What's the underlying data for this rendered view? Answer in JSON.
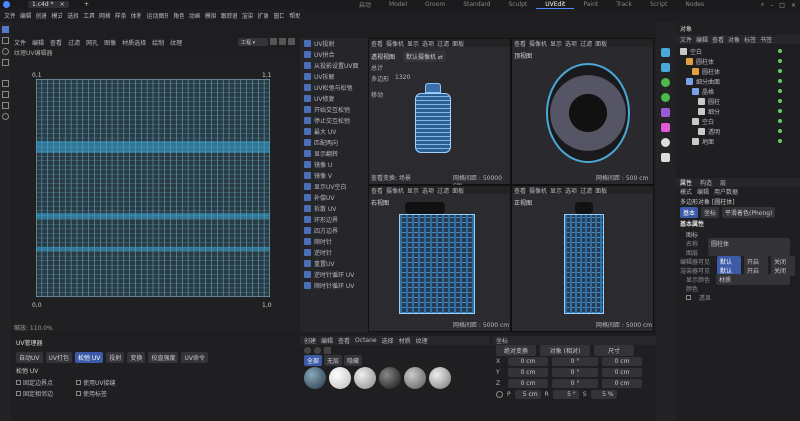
{
  "titlebar": {
    "tab_file": "1.c4d *",
    "tab_add": "+",
    "menu": [
      "文件",
      "编辑",
      "创建",
      "模式",
      "选择",
      "工具",
      "网格",
      "样条",
      "体积",
      "运动图形",
      "角色",
      "动画",
      "模拟",
      "跟踪器",
      "渲染",
      "扩展",
      "窗口",
      "帮助"
    ],
    "layouts": [
      "启动",
      "Model",
      "Groom",
      "Standard",
      "Sculpt",
      "UVEdit",
      "Paint",
      "Track",
      "Script",
      "Nodes"
    ],
    "active_layout": "UVEdit"
  },
  "uv_editor": {
    "menu": [
      "文件",
      "编辑",
      "查看",
      "过滤",
      "网孔",
      "图像",
      "材质选择",
      "绘制",
      "纹理"
    ],
    "mode_dropdown": "工程",
    "header_label": "纹理UV编辑器",
    "corner_tl": "0,1",
    "corner_tr": "1,1",
    "axis_zero": "0,0",
    "axis_one": "1,0",
    "zoom": "缩放: 110.0%"
  },
  "uv_tools": [
    "UV投射",
    "UV拼合",
    "从投影设置UV面",
    "UV拆解",
    "UV松弛与松弛",
    "UV修复",
    "开始交互松弛",
    "停止交互松弛",
    "最大 UV",
    "匹配两向",
    "显示翻转",
    "镜像 U",
    "镜像 V",
    "显示UV空白",
    "补偿UV",
    "拆散 UV",
    "环形边界",
    "四方边界",
    "顺时针",
    "逆时针",
    "重置UV",
    "逆时针循环 UV",
    "顺时针循环 UV"
  ],
  "viewport_menu": [
    "查看",
    "摄像机",
    "显示",
    "选项",
    "过滤",
    "面板"
  ],
  "viewports": {
    "perspective": {
      "title": "透视视图",
      "camera": "默认摄像机 ⇄",
      "stats_label": "总计",
      "poly_label": "多边形",
      "poly_value": "1320",
      "move_label": "移动",
      "footer": "查看变换: 场景",
      "grid": "网格间距 : 50000 cm"
    },
    "top": {
      "title": "顶视图",
      "grid": "网格间距 : 500 cm"
    },
    "right": {
      "title": "右视图",
      "grid": "网格间距 : 5000 cm"
    },
    "front": {
      "title": "正视图",
      "grid": "网格间距 : 5000 cm"
    }
  },
  "uv_manager": {
    "title": "UV管理器",
    "tabs": [
      "自动UV",
      "UV打包",
      "松弛 UV",
      "投射",
      "变换",
      "校直强度",
      "UV命令"
    ],
    "active_tab": "松弛 UV",
    "section": "松弛 UV",
    "options": [
      "固定边界点",
      "使用UV接缝",
      "固定相邻边",
      "使用标签"
    ]
  },
  "material_panel": {
    "menu": [
      "创建",
      "编辑",
      "查看",
      "Octane",
      "选择",
      "材质",
      "纹理"
    ],
    "filters": [
      "全部",
      "无层",
      "隐藏"
    ]
  },
  "coordinates": {
    "tab": "坐标",
    "mode1": "绝对变换",
    "mode2": "对象 (相对)",
    "mode3": "尺寸",
    "rows": [
      {
        "axis": "X",
        "pos": "0 cm",
        "rot": "0 °",
        "scale": "0 cm"
      },
      {
        "axis": "Y",
        "pos": "0 cm",
        "rot": "0 °",
        "scale": "0 cm"
      },
      {
        "axis": "Z",
        "pos": "0 cm",
        "rot": "0 °",
        "scale": "0 cm"
      }
    ],
    "bottom": {
      "p_label": "P",
      "p_val": "5 cm",
      "r_label": "R",
      "r_val": "5 °",
      "s_label": "S",
      "s_val": "5 %"
    }
  },
  "objects": {
    "title": "对象",
    "menu": [
      "文件",
      "编辑",
      "查看",
      "对象",
      "标签",
      "书签"
    ],
    "items": [
      {
        "name": "空白",
        "indent": 0,
        "color": "#c9c9c9"
      },
      {
        "name": "圆柱体",
        "indent": 1,
        "color": "#e0a040"
      },
      {
        "name": "圆柱体",
        "indent": 2,
        "color": "#e0a040"
      },
      {
        "name": "细分曲面",
        "indent": 1,
        "color": "#7aa0e8"
      },
      {
        "name": "晶格",
        "indent": 2,
        "color": "#7aa0e8"
      },
      {
        "name": "圆柱",
        "indent": 3,
        "color": "#c9c9c9"
      },
      {
        "name": "细分",
        "indent": 3,
        "color": "#c9c9c9"
      },
      {
        "name": "空白",
        "indent": 2,
        "color": "#c9c9c9"
      },
      {
        "name": "透明",
        "indent": 3,
        "color": "#c9c9c9"
      },
      {
        "name": "地面",
        "indent": 2,
        "color": "#c9c9c9"
      }
    ]
  },
  "attributes": {
    "tabs": [
      "属性",
      "构造",
      "层"
    ],
    "menu": [
      "模式",
      "编辑",
      "用户数据"
    ],
    "object_label": "多边形对象 [圆柱体]",
    "subtabs": [
      "基本",
      "坐标",
      "平滑着色(Phong)"
    ],
    "section": "基本属性",
    "icon_label": "图标",
    "name_label": "名称",
    "name_value": "圆柱体",
    "layer_label": "图层",
    "rows": [
      {
        "label": "编辑器可见",
        "v1": "默认",
        "v2": "开启",
        "v3": "关闭"
      },
      {
        "label": "渲染器可见",
        "v1": "默认",
        "v2": "开启",
        "v3": "关闭"
      }
    ],
    "display_color_label": "显示颜色",
    "display_color_value": "材质",
    "color_label": "颜色",
    "xray_label": "透显"
  }
}
